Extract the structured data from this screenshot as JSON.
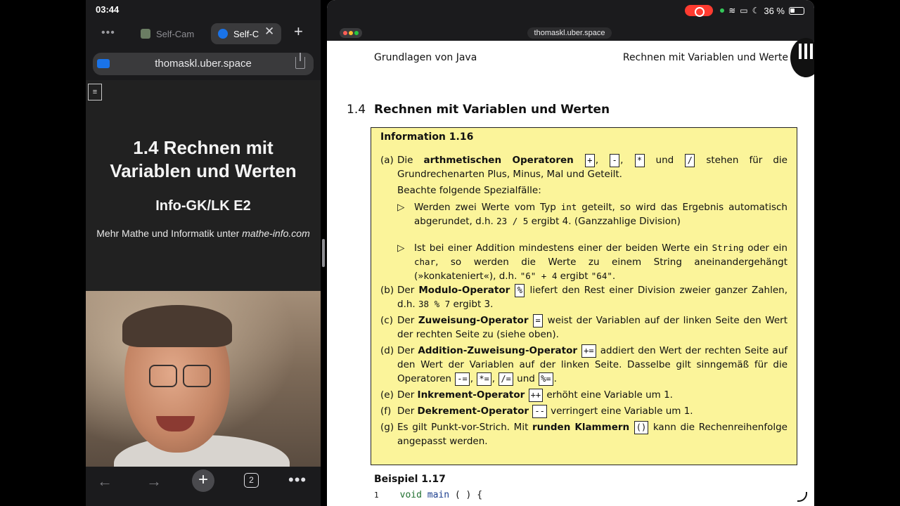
{
  "left_pane": {
    "status_time": "03:44",
    "tabs": [
      {
        "label": "Self-Cam"
      },
      {
        "label": "Self-C"
      }
    ],
    "url": "thomaskl.uber.space",
    "menu_glyph": "≡",
    "slide": {
      "title_line1": "1.4 Rechnen mit",
      "title_line2": "Variablen und Werten",
      "subtitle": "Info-GK/LK E2",
      "note_prefix": "Mehr Mathe und Informatik unter ",
      "note_link": "mathe-info.com"
    },
    "bottom": {
      "tab_count": "2"
    }
  },
  "right_pane": {
    "url": "thomaskl.uber.space",
    "battery": "36 %",
    "header_left": "Grundlagen von Java",
    "header_right": "Rechnen mit Variablen und Werte",
    "section_number": "1.4",
    "section_title": "Rechnen mit Variablen und Werten",
    "info": {
      "heading": "Information 1.16",
      "a": {
        "label": "(a)",
        "t1": "Die ",
        "b1": "arthmetischen Operatoren",
        "ops": [
          "+",
          "-",
          "*",
          "/"
        ],
        "und": " und ",
        "t2": " stehen für die Grundrechenarten Plus, Minus, Mal und Geteilt.",
        "note": "Beachte folgende Spezialfälle:",
        "bullet1_a": "Werden zwei Werte vom Typ ",
        "bullet1_code": "int",
        "bullet1_b": " geteilt, so wird das Ergebnis automatisch abgerundet, d.h. ",
        "bullet1_code2": "23 / 5",
        "bullet1_c": " ergibt 4. (Ganzzahlige Division)",
        "bullet2_a": "Ist bei einer Addition mindestens einer der beiden Werte ein ",
        "bullet2_code1": "String",
        "bullet2_b": " oder ein ",
        "bullet2_code2": "char",
        "bullet2_c": ", so werden die Werte zu einem String aneinandergehängt (»konkateniert«), d.h. ",
        "bullet2_code3": "\"6\" + 4",
        "bullet2_d": " ergibt ",
        "bullet2_code4": "\"64\"",
        "bullet2_e": "."
      },
      "b": {
        "label": "(b)",
        "t1": "Der ",
        "b1": "Modulo-Operator",
        "op": "%",
        "t2": " liefert den Rest einer Division zweier ganzer Zahlen, d.h. ",
        "code": "38 % 7",
        "t3": " ergibt 3."
      },
      "c": {
        "label": "(c)",
        "t1": "Der ",
        "b1": "Zuweisung-Operator",
        "op": "=",
        "t2": " weist der Variablen auf der linken Seite den Wert der rechten Seite zu (siehe oben)."
      },
      "d": {
        "label": "(d)",
        "t1": "Der ",
        "b1": "Addition-Zuweisung-Operator",
        "op": "+=",
        "t2": " addiert den Wert der rechten Seite auf den Wert der Variablen auf der linken Seite. Dasselbe gilt sinngemäß für die Operatoren ",
        "ops": [
          "-=",
          "*=",
          "/="
        ],
        "und": " und ",
        "last_op": "%=",
        "t3": "."
      },
      "e": {
        "label": "(e)",
        "t1": "Der ",
        "b1": "Inkrement-Operator",
        "op": "++",
        "t2": " erhöht eine Variable um 1."
      },
      "f": {
        "label": "(f)",
        "t1": "Der ",
        "b1": "Dekrement-Operator",
        "op": "--",
        "t2": " verringert eine Variable um 1."
      },
      "g": {
        "label": "(g)",
        "t1": "Es gilt Punkt-vor-Strich. Mit ",
        "b1": "runden Klammern",
        "op": "()",
        "t2": " kann die Rechenreihenfolge angepasst werden."
      }
    },
    "example_title": "Beispiel 1.17",
    "code_line1": {
      "num": "1",
      "kw": "void",
      "fn": "main",
      "rest": " ( ) {"
    }
  },
  "icons": {
    "tabs_more": "ellipsis-icon",
    "tab_close": "close-icon",
    "new_tab": "plus-icon",
    "share": "share-icon",
    "back": "back-arrow-icon",
    "forward": "forward-arrow-icon",
    "more": "ellipsis-icon"
  }
}
